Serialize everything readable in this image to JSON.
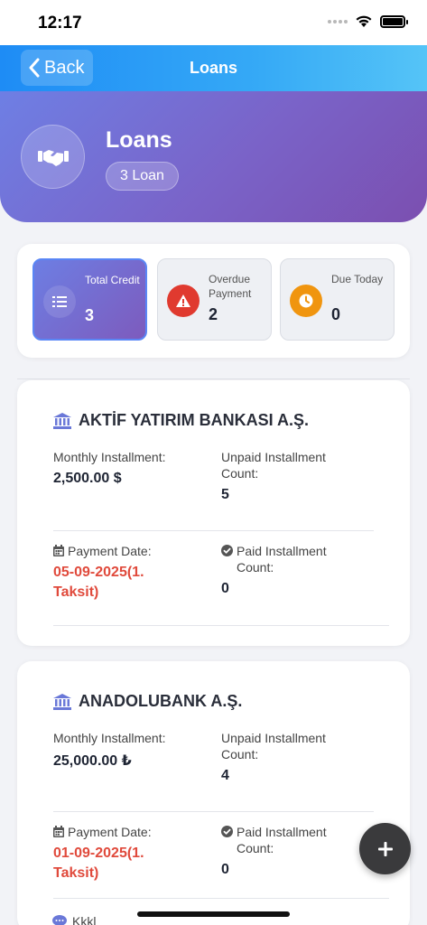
{
  "status_bar": {
    "time": "12:17"
  },
  "nav": {
    "back_label": "Back",
    "title": "Loans"
  },
  "hero": {
    "title": "Loans",
    "badge": "3 Loan",
    "icon": "handshake-icon"
  },
  "stats": [
    {
      "label": "Total Credit",
      "value": "3",
      "icon": "list-icon",
      "color": "#6a5fd0",
      "active": true
    },
    {
      "label": "Overdue Payment",
      "value": "2",
      "icon": "warning-icon",
      "color": "#e03a2f",
      "active": false
    },
    {
      "label": "Due Today",
      "value": "0",
      "icon": "clock-icon",
      "color": "#f0950f",
      "active": false
    }
  ],
  "loans": [
    {
      "bank": "AKTİF YATIRIM BANKASI A.Ş.",
      "monthly_label": "Monthly Installment:",
      "monthly_value": "2,500.00 $",
      "unpaid_label": "Unpaid Installment Count:",
      "unpaid_value": "5",
      "payment_label": "Payment Date:",
      "payment_value": "05-09-2025(1. Taksit)",
      "paid_label": "Paid Installment Count:",
      "paid_value": "0"
    },
    {
      "bank": "ANADOLUBANK A.Ş.",
      "monthly_label": "Monthly Installment:",
      "monthly_value": "25,000.00 ₺",
      "unpaid_label": "Unpaid Installment Count:",
      "unpaid_value": "4",
      "payment_label": "Payment Date:",
      "payment_value": "01-09-2025(1. Taksit)",
      "paid_label": "Paid Installment Count:",
      "paid_value": "0"
    }
  ],
  "peek": {
    "text": "Kkkl"
  },
  "colors": {
    "accent": "#1e8cf5",
    "hero": "#7a63c8",
    "danger": "#e04a3c",
    "fab": "#3a3a3c"
  }
}
